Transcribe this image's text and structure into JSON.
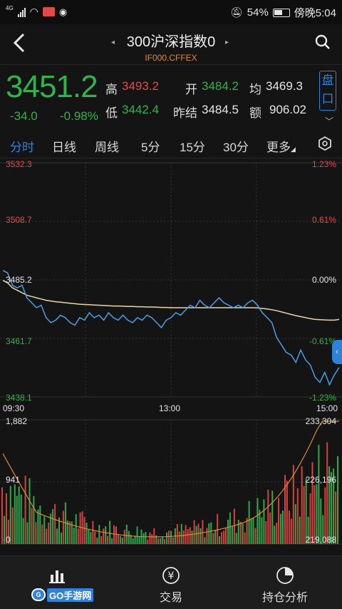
{
  "status_bar": {
    "network": "4G",
    "battery": "54%",
    "time": "傍晚5:04"
  },
  "header": {
    "title": "300沪深指数0",
    "subtitle": "IF000.CFFEX"
  },
  "quote": {
    "price": "3451.2",
    "change": "-34.0",
    "change_pct": "-0.98%",
    "high_label": "高",
    "high": "3493.2",
    "open_label": "开",
    "open": "3484.2",
    "avg_label": "均",
    "avg": "3469.3",
    "low_label": "低",
    "low": "3442.4",
    "prev_settle_label": "昨结",
    "prev_settle": "3484.5",
    "amount_label": "额",
    "amount": "906.02",
    "pankou": "盘口"
  },
  "tabs": [
    "分时",
    "日线",
    "周线",
    "5分",
    "15分",
    "30分",
    "更多"
  ],
  "active_tab": 0,
  "colors": {
    "up": "#e84848",
    "down": "#2fb44a",
    "accent": "#2f82d8",
    "price_line": "#4a9fe8",
    "avg_line": "#e8d7a8"
  },
  "chart_data": {
    "type": "line",
    "price_axis": {
      "left_ticks": [
        "3532.3",
        "3508.7",
        "3485.2",
        "3461.7",
        "3438.1"
      ],
      "right_ticks": [
        "1.23%",
        "0.61%",
        "0.00%",
        "-0.61%",
        "-1.23%"
      ],
      "ylim": [
        3438.1,
        3532.3
      ]
    },
    "time_labels": [
      "09:30",
      "13:00",
      "15:00"
    ],
    "series": [
      {
        "values": [
          3489,
          3488,
          3483,
          3482,
          3483,
          3478,
          3476,
          3474,
          3475,
          3470,
          3468,
          3469,
          3471,
          3470,
          3468,
          3467,
          3470,
          3469,
          3472,
          3470,
          3471,
          3469,
          3472,
          3470,
          3469,
          3471,
          3469,
          3468,
          3470,
          3469,
          3471,
          3470,
          3468,
          3466,
          3469,
          3470,
          3472,
          3471,
          3473,
          3475,
          3474,
          3477,
          3475,
          3474,
          3476,
          3478,
          3476,
          3475,
          3474,
          3475,
          3474,
          3476,
          3477,
          3475,
          3472,
          3470,
          3468,
          3462,
          3459,
          3456,
          3455,
          3452,
          3457,
          3453,
          3451,
          3446,
          3444,
          3448,
          3443,
          3447,
          3450
        ]
      },
      {
        "values": [
          3485,
          3484,
          3482,
          3481,
          3480,
          3479,
          3478.5,
          3478,
          3477.5,
          3477,
          3476.7,
          3476.4,
          3476.2,
          3476,
          3475.8,
          3475.6,
          3475.4,
          3475.3,
          3475.2,
          3475.1,
          3475,
          3474.9,
          3474.8,
          3474.7,
          3474.7,
          3474.6,
          3474.5,
          3474.5,
          3474.4,
          3474.4,
          3474.3,
          3474.3,
          3474.2,
          3474.1,
          3474.1,
          3474,
          3474,
          3474,
          3474,
          3474,
          3474,
          3474,
          3474,
          3474,
          3474,
          3474,
          3474,
          3474,
          3474,
          3474,
          3474,
          3474,
          3474,
          3473.9,
          3473.7,
          3473.5,
          3473.2,
          3472.8,
          3472.3,
          3471.8,
          3471.3,
          3470.8,
          3470.4,
          3470,
          3469.6,
          3469.3,
          3469.2,
          3469.1,
          3469,
          3469,
          3469.3
        ]
      }
    ],
    "volume_axis": {
      "left_ticks": [
        "1,882",
        "941",
        "0"
      ],
      "right_ticks": [
        "233,304",
        "226,196",
        "219,088"
      ]
    }
  },
  "bottom_nav": [
    {
      "label": "交易"
    },
    {
      "label": "持仓分析"
    }
  ]
}
